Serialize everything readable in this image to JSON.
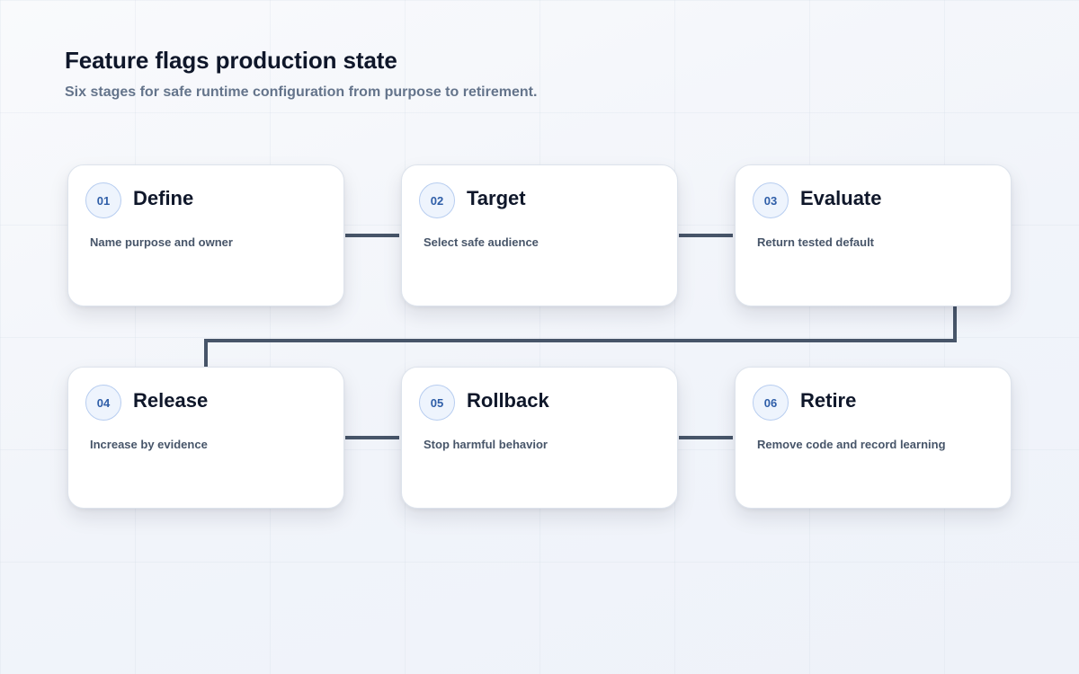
{
  "title": "Feature flags production state",
  "subtitle": "Six stages for safe runtime configuration from purpose to retirement.",
  "steps": [
    {
      "number": "01",
      "title": "Define",
      "description": "Name purpose and owner"
    },
    {
      "number": "02",
      "title": "Target",
      "description": "Select safe audience"
    },
    {
      "number": "03",
      "title": "Evaluate",
      "description": "Return tested default"
    },
    {
      "number": "04",
      "title": "Release",
      "description": "Increase by evidence"
    },
    {
      "number": "05",
      "title": "Rollback",
      "description": "Stop harmful behavior"
    },
    {
      "number": "06",
      "title": "Retire",
      "description": "Remove code and record learning"
    }
  ],
  "colors": {
    "background": "#f3f6fb",
    "card": "#ffffff",
    "connector": "#475569",
    "badge_text": "#2f5ea8",
    "badge_border": "#b7cdf0",
    "title_text": "#0f172a",
    "subtitle_text": "#64748b"
  }
}
